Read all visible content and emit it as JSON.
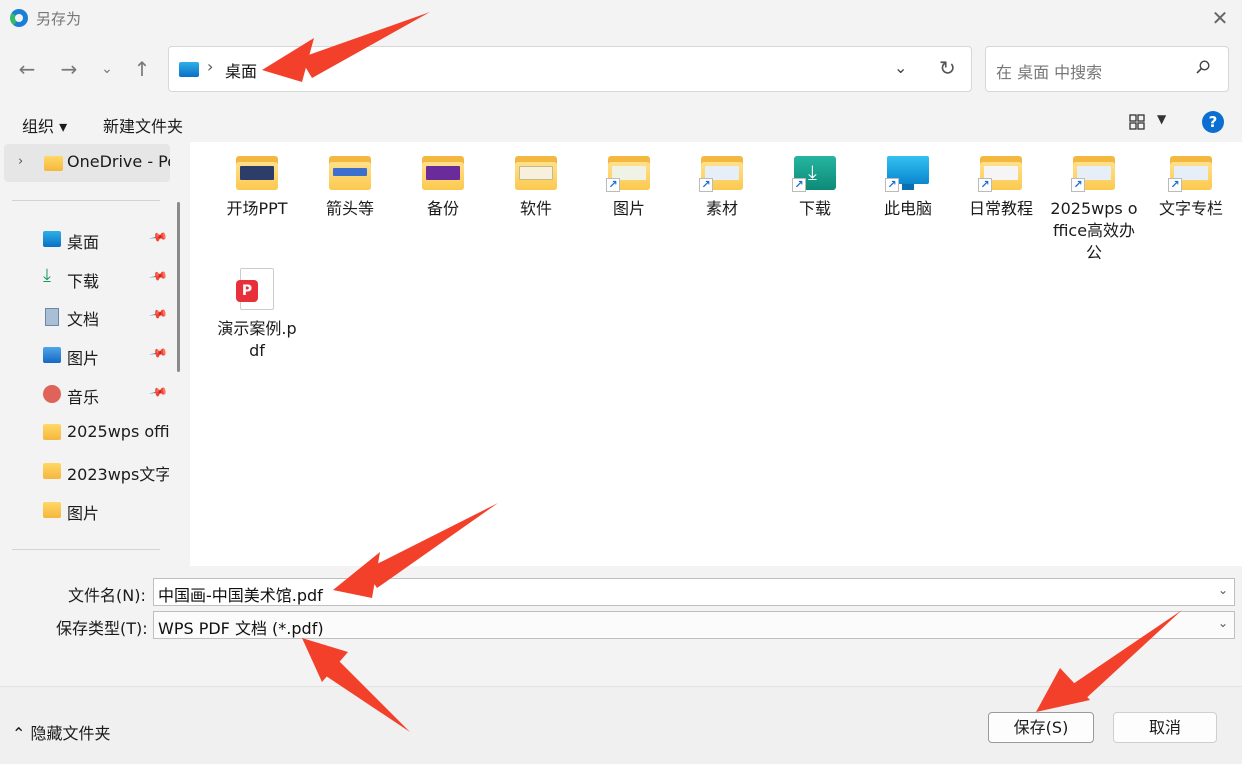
{
  "window": {
    "title": "另存为"
  },
  "address": {
    "path_item": "桌面",
    "search_placeholder": "在 桌面 中搜索"
  },
  "toolbar": {
    "organize": "组织 ▾",
    "new_folder": "新建文件夹",
    "help": "?"
  },
  "sidebar": {
    "onedrive": "OneDrive - Pe",
    "quick_access": [
      {
        "label": "桌面",
        "icon": "desktop-icon",
        "pinned": true
      },
      {
        "label": "下载",
        "icon": "download-icon",
        "pinned": true
      },
      {
        "label": "文档",
        "icon": "document-icon",
        "pinned": true
      },
      {
        "label": "图片",
        "icon": "pictures-icon",
        "pinned": true
      },
      {
        "label": "音乐",
        "icon": "music-icon",
        "pinned": true
      },
      {
        "label": "2025wps offi",
        "icon": "folder-icon",
        "pinned": false
      },
      {
        "label": "2023wps文字",
        "icon": "folder-icon",
        "pinned": false
      },
      {
        "label": "图片",
        "icon": "folder-icon",
        "pinned": false
      }
    ]
  },
  "files": [
    {
      "name": "开场PPT",
      "type": "folder"
    },
    {
      "name": "箭头等",
      "type": "folder"
    },
    {
      "name": "备份",
      "type": "folder"
    },
    {
      "name": "软件",
      "type": "folder"
    },
    {
      "name": "图片",
      "type": "folder-shortcut"
    },
    {
      "name": "素材",
      "type": "folder-shortcut"
    },
    {
      "name": "下载",
      "type": "download-shortcut"
    },
    {
      "name": "此电脑",
      "type": "pc-shortcut"
    },
    {
      "name": "日常教程",
      "type": "folder-shortcut"
    },
    {
      "name": "2025wps office高效办公",
      "type": "folder-shortcut"
    },
    {
      "name": "文字专栏",
      "type": "folder-shortcut"
    },
    {
      "name": "演示案例.pdf",
      "type": "pdf"
    }
  ],
  "form": {
    "filename_label": "文件名(N):",
    "filename_value": "中国画-中国美术馆.pdf",
    "filetype_label": "保存类型(T):",
    "filetype_value": "WPS PDF 文档 (*.pdf)"
  },
  "footer": {
    "hide_folders": "⌃ 隐藏文件夹",
    "save": "保存(S)",
    "cancel": "取消"
  },
  "colors": {
    "accent": "#0a6fd0",
    "annotation_arrow": "#f2402a"
  }
}
